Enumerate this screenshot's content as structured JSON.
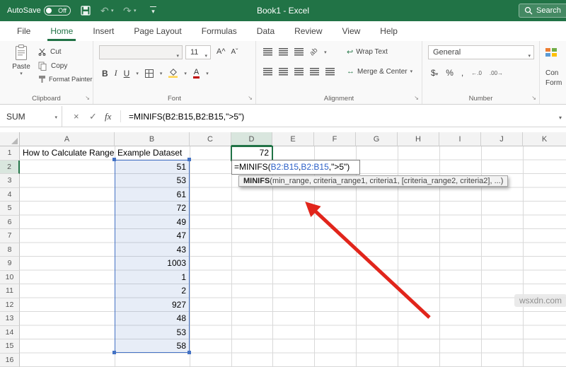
{
  "colors": {
    "excel_green": "#217346",
    "reference_blue": "#4472c4",
    "formula_ref_text": "#2b5fc7",
    "arrow_red": "#e1251b",
    "selection_fill": "#e8eef8"
  },
  "icons": {
    "dropdown": "▾",
    "dialog_launcher": "↘",
    "cancel": "×",
    "enter": "✓",
    "fx": "fx",
    "undo": "↶",
    "redo": "↷",
    "wrap": "↩",
    "merge": "↔"
  },
  "title_bar": {
    "autosave_label": "AutoSave",
    "autosave_state": "Off",
    "window_title": "Book1  -  Excel",
    "search_label": "Search"
  },
  "menu_tabs": [
    {
      "label": "File"
    },
    {
      "label": "Home",
      "active": true
    },
    {
      "label": "Insert"
    },
    {
      "label": "Page Layout"
    },
    {
      "label": "Formulas"
    },
    {
      "label": "Data"
    },
    {
      "label": "Review"
    },
    {
      "label": "View"
    },
    {
      "label": "Help"
    }
  ],
  "ribbon": {
    "clipboard": {
      "group_label": "Clipboard",
      "paste_label": "Paste",
      "cut_label": "Cut",
      "copy_label": "Copy",
      "format_painter_label": "Format Painter"
    },
    "font": {
      "group_label": "Font",
      "size_value": "11",
      "bold_label": "B",
      "italic_label": "I",
      "underline_label": "U",
      "grow_glyph": "A^",
      "shrink_glyph": "Aˇ",
      "orientation_glyph": "ab"
    },
    "alignment": {
      "group_label": "Alignment",
      "wrap_text_label": "Wrap Text",
      "merge_center_label": "Merge & Center"
    },
    "number": {
      "group_label": "Number",
      "format_value": "General",
      "currency_label": "$",
      "percent_label": "%",
      "comma_label": ",",
      "inc_decimal_glyph": "←.0",
      "dec_decimal_glyph": ".00→"
    },
    "styles_partial": {
      "line1": "Con",
      "line2": "Form"
    }
  },
  "formula_bar": {
    "name_box_value": "SUM",
    "formula": "=MINIFS(B2:B15,B2:B15,\">5\")"
  },
  "grid": {
    "column_headers": [
      "A",
      "B",
      "C",
      "D",
      "E",
      "F",
      "G",
      "H",
      "I",
      "J",
      "K"
    ],
    "row_headers": [
      "1",
      "2",
      "3",
      "4",
      "5",
      "6",
      "7",
      "8",
      "9",
      "10",
      "11",
      "12",
      "13",
      "14",
      "15",
      "16"
    ],
    "active_column": "D",
    "active_row": "2",
    "cells": [
      {
        "ref": "A1",
        "value": "How to Calculate Range",
        "align": "left"
      },
      {
        "ref": "B1",
        "value": "Example Dataset",
        "align": "left"
      },
      {
        "ref": "D1",
        "value": "72",
        "align": "right"
      },
      {
        "ref": "B2",
        "value": "51",
        "align": "right"
      },
      {
        "ref": "B3",
        "value": "53",
        "align": "right"
      },
      {
        "ref": "B4",
        "value": "61",
        "align": "right"
      },
      {
        "ref": "B5",
        "value": "72",
        "align": "right"
      },
      {
        "ref": "B6",
        "value": "49",
        "align": "right"
      },
      {
        "ref": "B7",
        "value": "47",
        "align": "right"
      },
      {
        "ref": "B8",
        "value": "43",
        "align": "right"
      },
      {
        "ref": "B9",
        "value": "1003",
        "align": "right"
      },
      {
        "ref": "B10",
        "value": "1",
        "align": "right"
      },
      {
        "ref": "B11",
        "value": "2",
        "align": "right"
      },
      {
        "ref": "B12",
        "value": "927",
        "align": "right"
      },
      {
        "ref": "B13",
        "value": "48",
        "align": "right"
      },
      {
        "ref": "B14",
        "value": "53",
        "align": "right"
      },
      {
        "ref": "B15",
        "value": "58",
        "align": "right"
      }
    ],
    "edit_cell": {
      "ref": "D2",
      "segments": [
        {
          "text": "=MINIFS(",
          "color": "#000000"
        },
        {
          "text": "B2:B15",
          "color": "#2b5fc7"
        },
        {
          "text": ",",
          "color": "#000000"
        },
        {
          "text": "B2:B15",
          "color": "#2b5fc7"
        },
        {
          "text": ",\">5\")",
          "color": "#000000"
        }
      ]
    },
    "function_tooltip": {
      "name": "MINIFS",
      "signature": "(min_range, criteria_range1, criteria1, [criteria_range2, criteria2], ...)"
    }
  },
  "watermark": "wsxdn.com"
}
